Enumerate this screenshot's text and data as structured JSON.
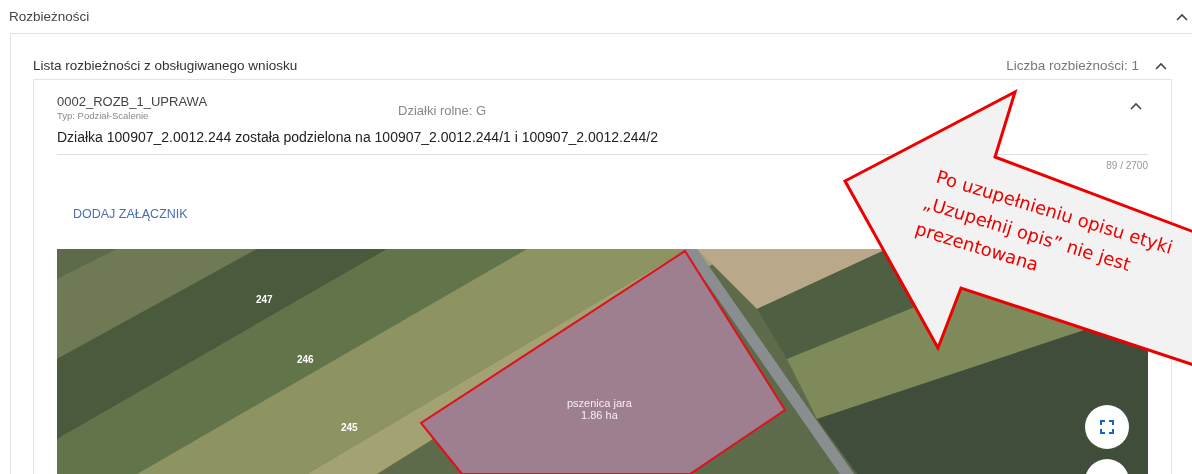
{
  "section": {
    "title": "Rozbieżności",
    "expanded": true
  },
  "list": {
    "title": "Lista rozbieżności z obsługiwanego wniosku",
    "count": "Liczba rozbieżności: 1",
    "expanded": true,
    "items": [
      {
        "code": "0002_ROZB_1_UPRAWA",
        "type": "Typ: Podział-Scalenie",
        "plots": "Działki rolne: G",
        "expanded": true,
        "description": "Działka 100907_2.0012.244 została podzielona na 100907_2.0012.244/1 i 100907_2.0012.244/2",
        "counter": "89 / 2700",
        "attach_button": "DODAJ ZAŁĄCZNIK",
        "map": {
          "parcel_numbers": [
            "247",
            "246",
            "245"
          ],
          "crop": "pszenica jara",
          "area": "1.86 ha"
        }
      }
    ]
  },
  "annotation": {
    "lines": [
      "Po uzupełnieniu opisu etyki",
      "„Uzupełnij opis” nie jest",
      "prezentowana"
    ]
  }
}
